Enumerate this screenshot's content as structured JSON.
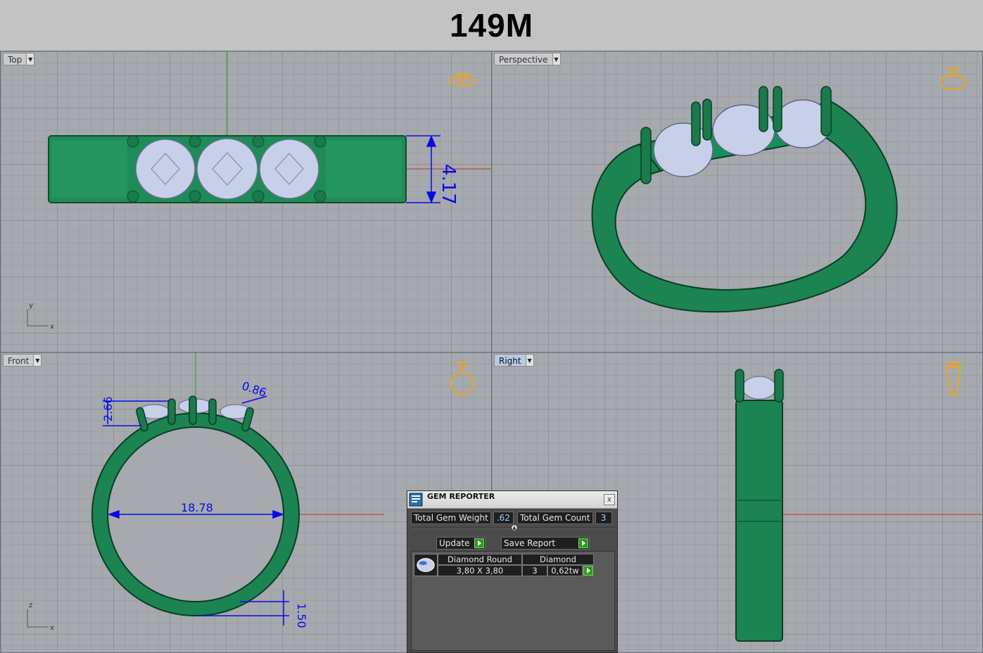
{
  "header": {
    "title": "149M"
  },
  "viewports": {
    "top": {
      "label": "Top",
      "dim_height": "4.17",
      "axis_x": "x",
      "axis_y": "y"
    },
    "perspective": {
      "label": "Perspective"
    },
    "front": {
      "label": "Front",
      "dim_stone_height": "2.66",
      "dim_prong": "0.86",
      "dim_inner": "18.78",
      "dim_band": "1.50",
      "axis_x": "x",
      "axis_y": "z"
    },
    "right": {
      "label": "Right"
    }
  },
  "gem_reporter": {
    "title": "GEM REPORTER",
    "close": "x",
    "total_weight_label": "Total Gem Weight",
    "total_weight_value": ".62",
    "total_count_label": "Total Gem Count",
    "total_count_value": "3",
    "update_label": "Update",
    "save_label": "Save Report",
    "rows": [
      {
        "shape": "Diamond Round",
        "material": "Diamond",
        "size": "3,80 X 3,80",
        "count": "3",
        "weight": "0,62tw"
      }
    ]
  },
  "colors": {
    "metal": "#1f8a5a",
    "metal_dark": "#0d5a36",
    "gem": "#c8cfe8",
    "dimension": "#0a0ae6",
    "badge": "#f2a31b"
  }
}
